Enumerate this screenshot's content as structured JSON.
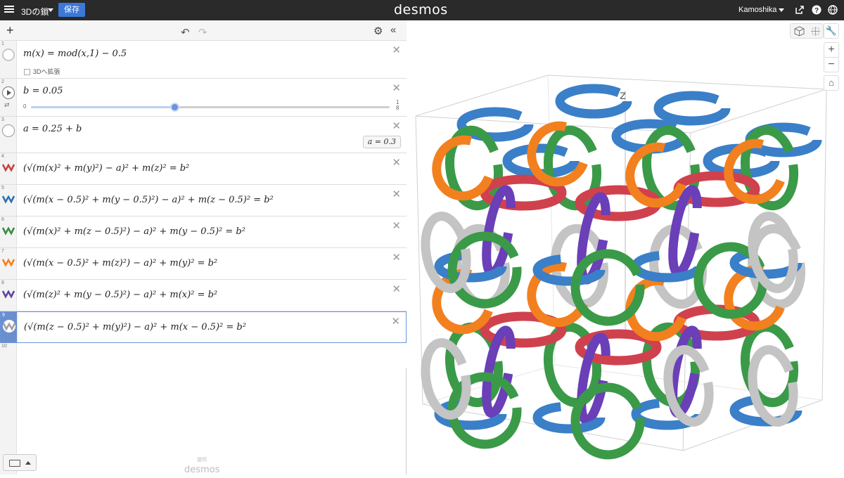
{
  "topbar": {
    "doc_title": "3Dの鎖",
    "save_label": "保存",
    "logo": "desmos",
    "user": "Kamoshika"
  },
  "expressions": [
    {
      "num": "1",
      "latex": "m(x) = mod(x,1) − 0.5",
      "checkbox_label": "3Dへ拡張",
      "color": ""
    },
    {
      "num": "2",
      "latex": "b = 0.05",
      "slider_min": "0",
      "slider_max": "1",
      "slider_max_den": "8",
      "slider_value": 0.4
    },
    {
      "num": "3",
      "latex": "a = 0.25 + b",
      "result": "a = 0.3"
    },
    {
      "num": "4",
      "latex": "(√(m(x)² + m(y)²) − a)² + m(z)² = b²",
      "color": "#c74440"
    },
    {
      "num": "5",
      "latex": "(√(m(x − 0.5)² + m(y − 0.5)²) − a)² + m(z − 0.5)² = b²",
      "color": "#2d70b3"
    },
    {
      "num": "6",
      "latex": "(√(m(x)² + m(z − 0.5)²) − a)² + m(y − 0.5)² = b²",
      "color": "#388c46"
    },
    {
      "num": "7",
      "latex": "(√(m(x − 0.5)² + m(z)²) − a)² + m(y)² = b²",
      "color": "#fa7e19"
    },
    {
      "num": "8",
      "latex": "(√(m(z)² + m(y − 0.5)²) − a)² + m(x)² = b²",
      "color": "#6042a6"
    },
    {
      "num": "9",
      "latex": "(√(m(z − 0.5)² + m(y)²) − a)² + m(x − 0.5)² = b²",
      "color": "#a0a0a0"
    },
    {
      "num": "10",
      "latex": ""
    }
  ],
  "watermark": {
    "small": "提供",
    "logo": "desmos"
  },
  "graph": {
    "axis_label": "z"
  },
  "colors": {
    "red": "#d0414e",
    "blue": "#3a7fc8",
    "green": "#3a9a48",
    "orange": "#f2801f",
    "purple": "#6a3fb8",
    "gray": "#c4c4c4"
  }
}
